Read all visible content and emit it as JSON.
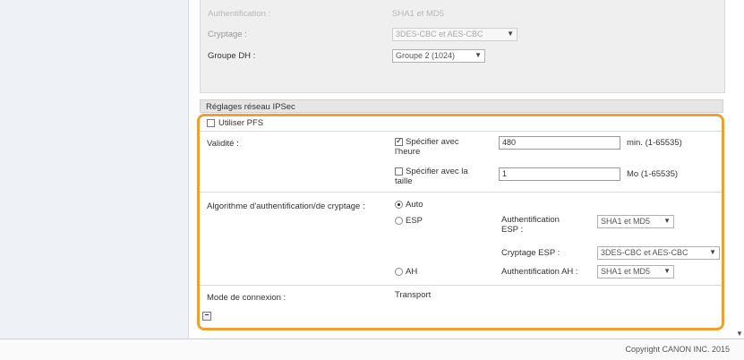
{
  "top_section": {
    "authentication": {
      "label": "Authentification :",
      "value": "SHA1 et MD5"
    },
    "encryption": {
      "label": "Cryptage :",
      "value": "3DES-CBC et AES-CBC"
    },
    "dh_group": {
      "label": "Groupe DH :",
      "value": "Groupe 2 (1024)"
    }
  },
  "ipsec": {
    "header": "Réglages réseau IPSec",
    "use_pfs_label": "Utiliser PFS",
    "validity": {
      "label": "Validité :",
      "by_time_label_1": "Spécifier avec",
      "by_time_label_2": "l'heure",
      "time_value": "480",
      "time_unit": "min. (1-65535)",
      "by_size_label_1": "Spécifier avec la",
      "by_size_label_2": "taille",
      "size_value": "1",
      "size_unit": "Mo (1-65535)"
    },
    "algorithm": {
      "label": "Algorithme d'authentification/de cryptage :",
      "auto_label": "Auto",
      "esp_label": "ESP",
      "esp_auth_label_1": "Authentification",
      "esp_auth_label_2": "ESP :",
      "esp_auth_value": "SHA1 et MD5",
      "esp_enc_label": "Cryptage ESP :",
      "esp_enc_value": "3DES-CBC et AES-CBC",
      "ah_label": "AH",
      "ah_auth_label": "Authentification AH :",
      "ah_auth_value": "SHA1 et MD5"
    },
    "connection_mode": {
      "label": "Mode de connexion :",
      "value": "Transport"
    }
  },
  "footer": {
    "copyright": "Copyright CANON INC. 2015"
  }
}
